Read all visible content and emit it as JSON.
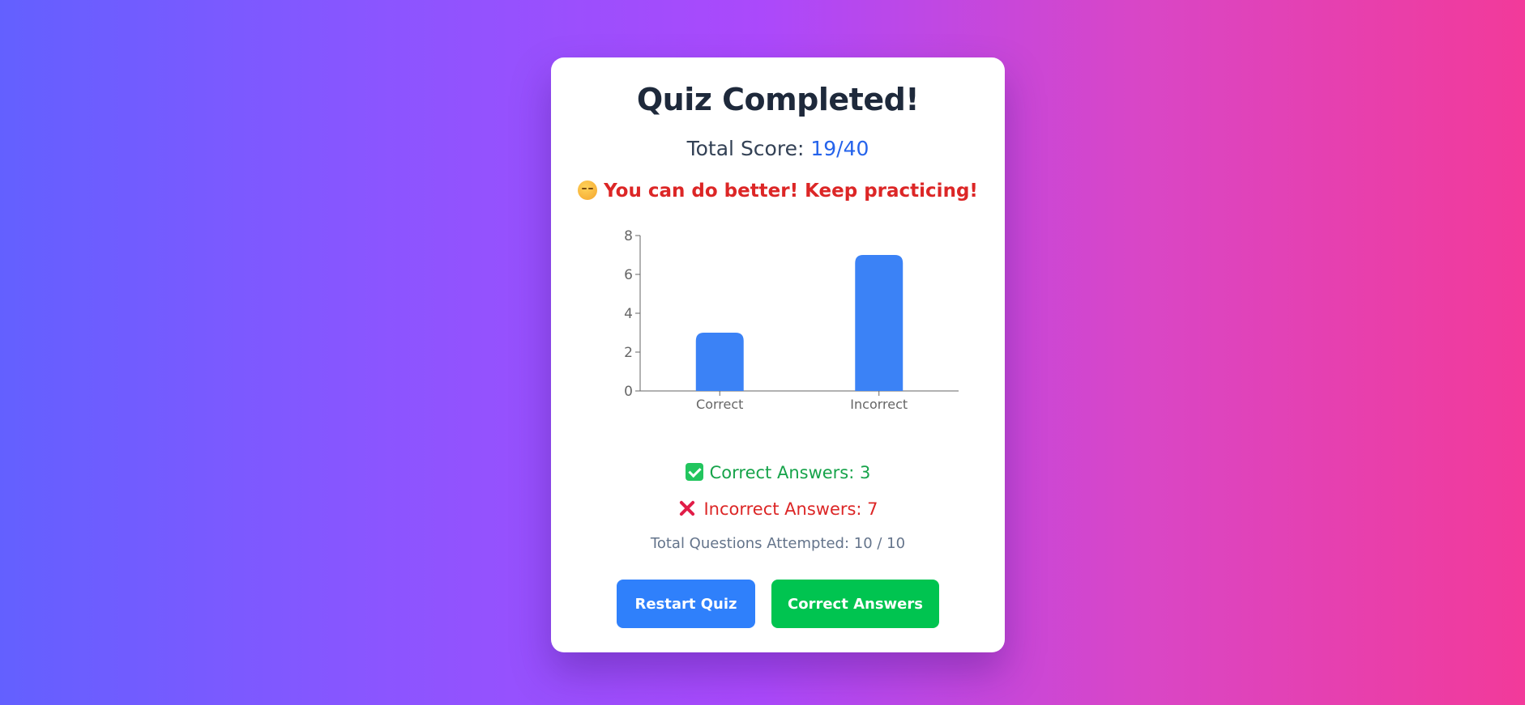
{
  "title": "Quiz Completed!",
  "score": {
    "label": "Total Score:",
    "value": "19/40"
  },
  "feedback": {
    "text": "You can do better! Keep practicing!",
    "emoji_icon": "pensive-face-icon"
  },
  "chart_data": {
    "type": "bar",
    "categories": [
      "Correct",
      "Incorrect"
    ],
    "values": [
      3,
      7
    ],
    "ylim": [
      0,
      8
    ],
    "yticks": [
      0,
      2,
      4,
      6,
      8
    ],
    "bar_color": "#3b82f6",
    "grid": false,
    "title": "",
    "xlabel": "",
    "ylabel": ""
  },
  "stats": {
    "correct_label": "Correct Answers: 3",
    "incorrect_label": "Incorrect Answers: 7",
    "total_label": "Total Questions Attempted: 10 / 10"
  },
  "buttons": {
    "restart": "Restart Quiz",
    "answers": "Correct Answers"
  },
  "colors": {
    "score": "#2563eb",
    "feedback": "#dc2626",
    "correct": "#16a34a",
    "incorrect": "#dc2626",
    "restart_button": "#2f80fb",
    "answers_button": "#00c450"
  }
}
